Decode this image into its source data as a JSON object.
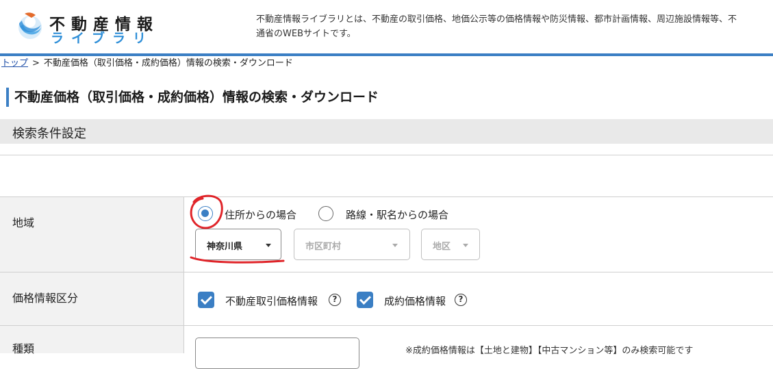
{
  "header": {
    "logo_main": "不動産情報",
    "logo_sub": "ライブラリ",
    "description_line1": "不動産情報ライブラリとは、不動産の取引価格、地価公示等の価格情報や防災情報、都市計画情報、周辺施設情報等、不",
    "description_line2": "通省のWEBサイトです。"
  },
  "breadcrumb": {
    "home": "トップ",
    "separator": ">",
    "current": "不動産価格（取引価格・成約価格）情報の検索・ダウンロード"
  },
  "page_title": "不動産価格（取引価格・成約価格）情報の検索・ダウンロード",
  "section_title": "検索条件設定",
  "form": {
    "region": {
      "label": "地域",
      "radio_address": "住所からの場合",
      "radio_station": "路線・駅名からの場合",
      "selected_radio": "address",
      "prefecture": "神奈川県",
      "city": "市区町村",
      "district": "地区"
    },
    "price_type": {
      "label": "価格情報区分",
      "option1": "不動産取引価格情報",
      "option2": "成約価格情報",
      "help": "?"
    },
    "kind": {
      "label": "種類",
      "note": "※成約価格情報は【土地と建物】【中古マンション等】のみ検索可能です"
    }
  },
  "colors": {
    "accent": "#3b7fc4",
    "annotation": "#e0252a"
  }
}
